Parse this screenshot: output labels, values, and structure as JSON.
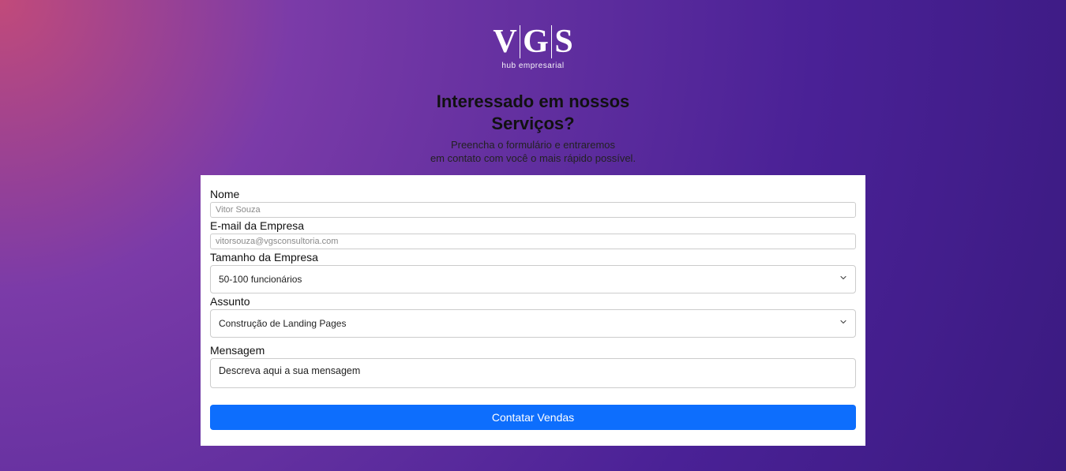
{
  "logo": {
    "l1": "V",
    "l2": "G",
    "l3": "S",
    "sub": "hub empresarial"
  },
  "heading": {
    "line1": "Interessado em nossos",
    "line2": "Serviços?"
  },
  "sub": {
    "line1": "Preencha o formulário e entraremos",
    "line2": "em contato com você o mais rápido possível."
  },
  "form": {
    "name": {
      "label": "Nome",
      "placeholder": "Vitor Souza"
    },
    "email": {
      "label": "E-mail da Empresa",
      "placeholder": "vitorsouza@vgsconsultoria.com"
    },
    "size": {
      "label": "Tamanho da Empresa",
      "selected": "50-100 funcionários"
    },
    "subject": {
      "label": "Assunto",
      "selected": "Construção de Landing Pages"
    },
    "message": {
      "label": "Mensagem",
      "placeholder": "Descreva aqui a sua mensagem"
    },
    "submit": "Contatar Vendas"
  }
}
